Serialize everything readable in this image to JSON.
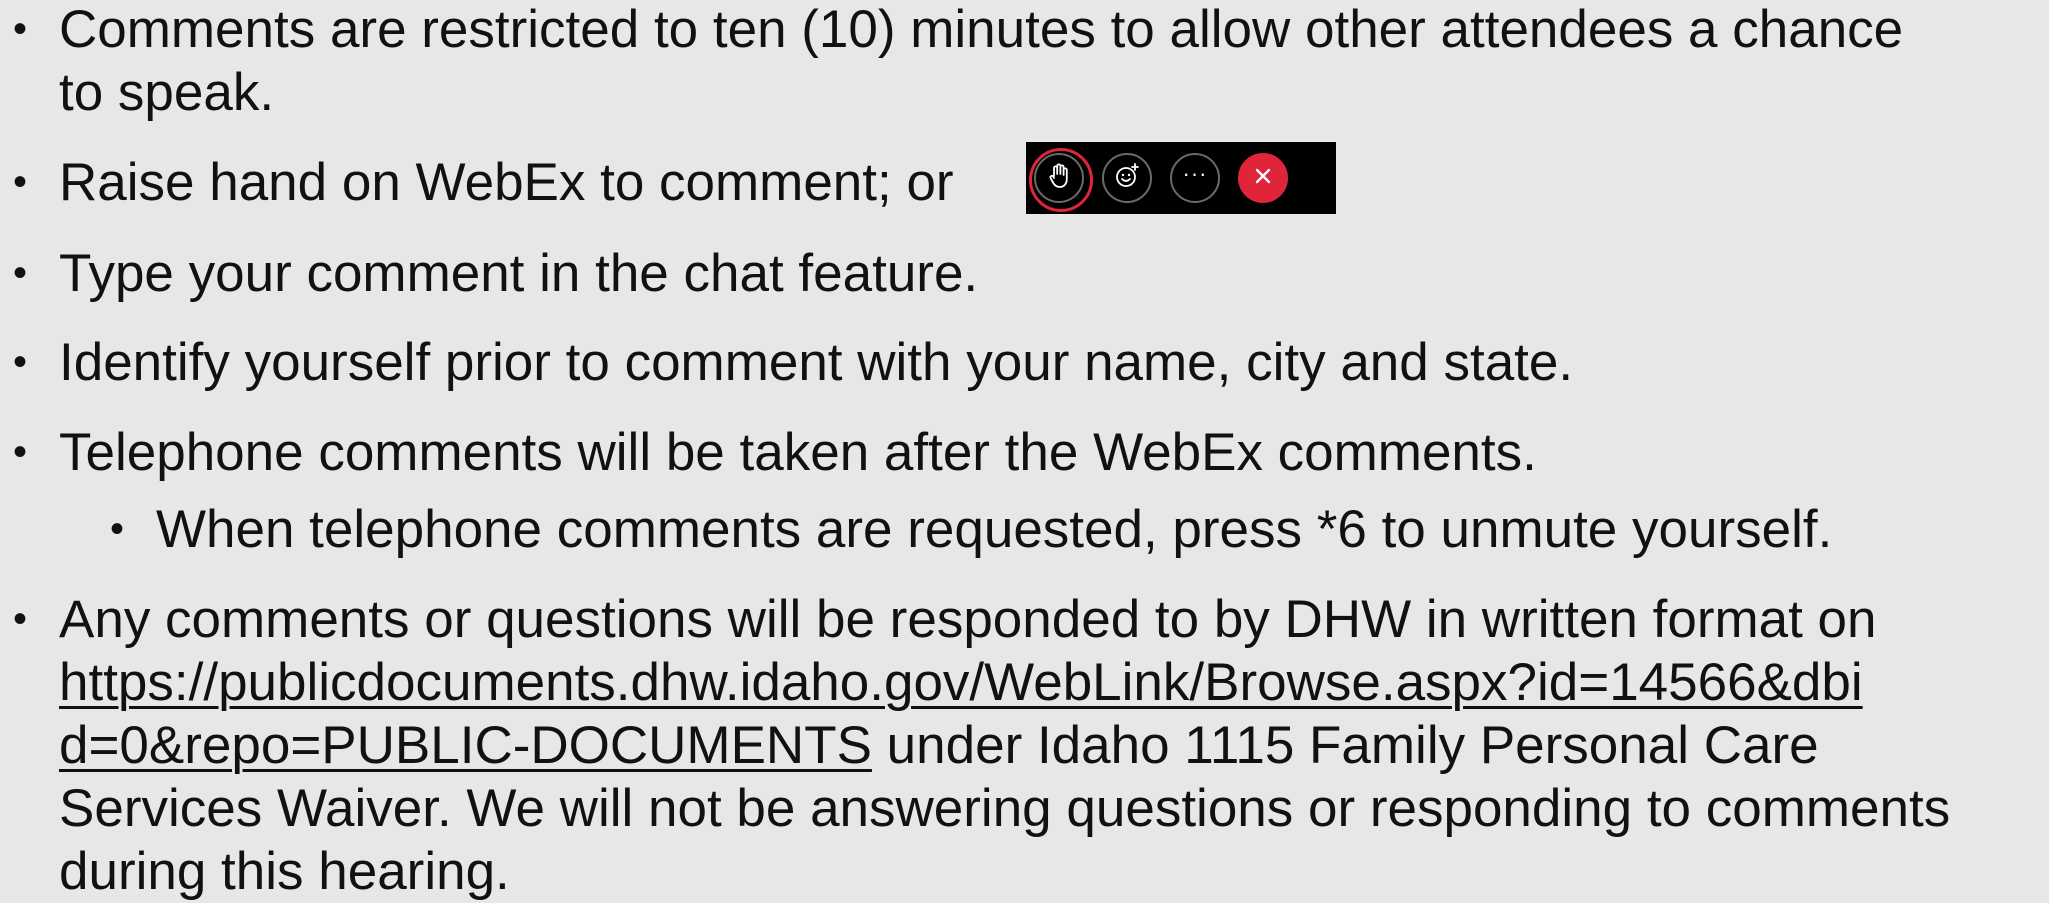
{
  "bullets": [
    {
      "id": "time-limit",
      "lines": [
        "Comments are restricted to ten (10) minutes to allow other attendees a chance",
        "to speak."
      ]
    },
    {
      "id": "raise-hand",
      "text": "Raise hand on WebEx to comment; or"
    },
    {
      "id": "chat",
      "text": "Type your comment in the chat feature."
    },
    {
      "id": "identify",
      "text": "Identify yourself prior to comment with your name, city and state."
    },
    {
      "id": "telephone",
      "text": "Telephone comments will be taken after the WebEx comments."
    },
    {
      "id": "unmute",
      "text": "When telephone comments are requested, press *6 to unmute yourself."
    },
    {
      "id": "responses",
      "line1": "Any comments or questions will be responded to by DHW in written format on",
      "link_line1": "https://publicdocuments.dhw.idaho.gov/WebLink/Browse.aspx?id=14566&dbi",
      "link_line2": "d=0&repo=PUBLIC-DOCUMENTS",
      "after_link": " under Idaho 1115 Family Personal Care",
      "line4": "Services Waiver. We will not be answering questions or responding to comments",
      "line5": "during this hearing."
    }
  ],
  "bullet_glyph": "•",
  "toolbar": {
    "buttons": [
      {
        "name": "raise-hand",
        "icon": "hand-icon",
        "highlighted": true
      },
      {
        "name": "reactions",
        "icon": "smiley-icon"
      },
      {
        "name": "more-options",
        "icon": "ellipsis-icon",
        "label": "···"
      },
      {
        "name": "leave-meeting",
        "icon": "close-icon",
        "color": "#e0243a"
      }
    ]
  }
}
